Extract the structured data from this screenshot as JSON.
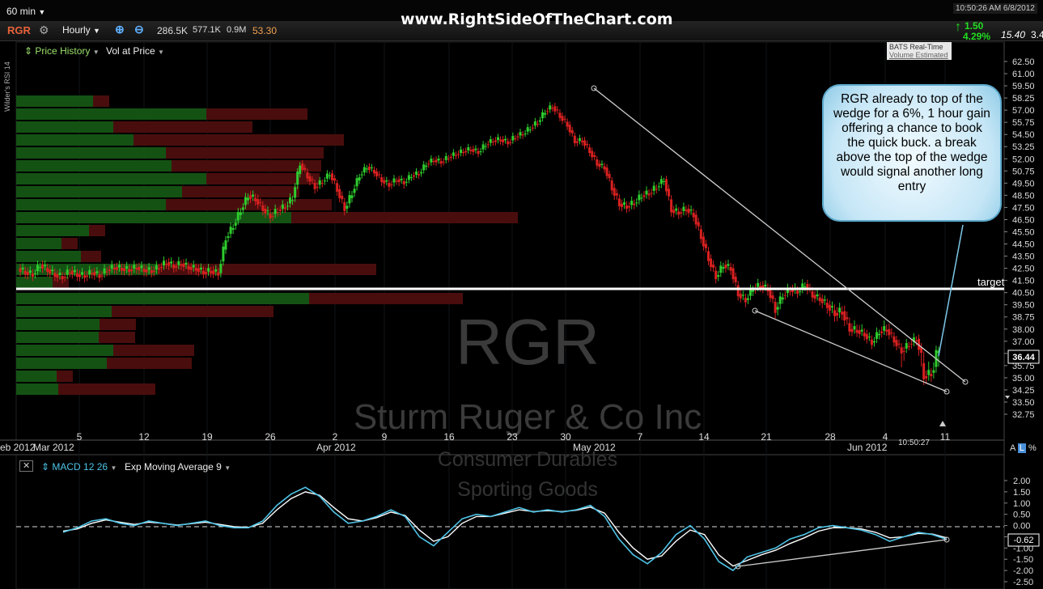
{
  "toolbar": {
    "interval": "60 min",
    "symbol": "RGR",
    "bar_period": "Hourly",
    "volume": "286.5K",
    "avg_vol": "577.1K",
    "vol_extra": "0.9M",
    "rsi_value": "53.30",
    "timestamp": "10:50:26 AM 6/8/2012",
    "bats_title": "BATS Real-Time",
    "bats_sub": "Volume Estimated",
    "change": "1.50",
    "change_pct": "4.29%",
    "last": "15.40",
    "last_extra": "3.4",
    "icons": [
      "chevron-down-icon",
      "settings-icon",
      "zoom-in-icon",
      "zoom-out-icon"
    ]
  },
  "brand": "www.RightSideOfTheChart.com",
  "panel1": {
    "label1": "Price History",
    "label2": "Vol at Price",
    "side_label": "Wilder's RSI 14",
    "watermark_symbol": "RGR",
    "watermark_company": "Sturm Ruger & Co Inc",
    "watermark_sector": "Consumer Durables",
    "watermark_industry": "Sporting Goods",
    "price_time_label": "10:50:27",
    "target_label": "target",
    "last_price_label": "36.44"
  },
  "panel2": {
    "label1": "MACD 12 26",
    "label2": "Exp Moving Average 9",
    "last_value_label": "-0.62",
    "scale_icons": [
      "A",
      "L",
      "%"
    ]
  },
  "callout": "RGR already to top of the wedge for a 6%, 1 hour gain offering  a chance to book the quick buck.  a break above the top of the wedge would signal another long entry",
  "colors": {
    "up": "#2ecc2e",
    "down": "#d82020",
    "macd": "#4fc3e6",
    "signal": "#ffffff",
    "target": "#ffffff",
    "wedge": "#d0d0d0",
    "callout_border": "#5da9cc"
  },
  "chart_data": [
    {
      "type": "line",
      "title": "RGR",
      "xlabel": "",
      "ylabel": "",
      "ylim": [
        32.75,
        62.5
      ],
      "x_tick_labels": [
        "eb 2012",
        "Mar 2012",
        "5",
        "12",
        "19",
        "26",
        "Apr 2012",
        "2",
        "9",
        "16",
        "23",
        "30",
        "May 2012",
        "7",
        "14",
        "21",
        "28",
        "4",
        "Jun 2012",
        "11"
      ],
      "y_tick_labels": [
        "62.50",
        "61.00",
        "59.50",
        "58.25",
        "57.00",
        "55.75",
        "54.50",
        "53.25",
        "52.00",
        "50.75",
        "49.50",
        "48.50",
        "47.50",
        "46.50",
        "45.50",
        "44.50",
        "43.50",
        "42.50",
        "41.50",
        "40.50",
        "39.50",
        "38.75",
        "38.00",
        "37.00",
        "36.00",
        "35.75",
        "35.00",
        "34.25",
        "33.50",
        "32.75"
      ],
      "series": [
        {
          "values": [
            42.5,
            42.2,
            42.0,
            42.8,
            42.4,
            42.0,
            41.8,
            42.3,
            42.0,
            41.9,
            42.2,
            41.9,
            42.4,
            42.6,
            42.5,
            42.4,
            42.6,
            42.4,
            42.3,
            42.6,
            43.0,
            42.7,
            42.9,
            42.6,
            42.5,
            42.2,
            42.3,
            42.1,
            45.0,
            46.0,
            47.3,
            48.5,
            48.2,
            47.4,
            46.8,
            47.3,
            47.6,
            48.3,
            51.5,
            50.2,
            49.2,
            49.7,
            50.5,
            49.0,
            47.4,
            48.7,
            50.3,
            51.2,
            50.7,
            49.8,
            49.4,
            49.9,
            49.6,
            50.3,
            50.5,
            51.5,
            51.9,
            51.7,
            52.2,
            52.5,
            52.8,
            53.0,
            52.7,
            53.5,
            53.9,
            54.0,
            53.7,
            54.3,
            54.6,
            55.2,
            55.8,
            56.9,
            57.4,
            56.4,
            55.5,
            53.8,
            53.9,
            52.8,
            51.5,
            51.1,
            49.1,
            47.8,
            47.6,
            47.9,
            48.5,
            48.7,
            49.2,
            49.9,
            47.3,
            47.1,
            47.4,
            46.9,
            45.1,
            43.3,
            41.8,
            42.8,
            42.5,
            40.4,
            39.9,
            40.9,
            41.1,
            40.8,
            39.2,
            40.3,
            40.8,
            40.6,
            41.2,
            40.3,
            40.0,
            39.5,
            39.0,
            39.1,
            38.0,
            37.9,
            37.6,
            36.9,
            37.8,
            38.0,
            37.1,
            36.2,
            36.8,
            37.2,
            35.1,
            35.3,
            36.4
          ]
        }
      ],
      "annotations": [
        {
          "text": "target",
          "price": 41.35,
          "kind": "horizontal line"
        },
        {
          "text": "wedge upper",
          "from": [
            59.2,
            "May 1"
          ],
          "to": [
            34.9,
            "Jun 12"
          ]
        },
        {
          "text": "wedge lower",
          "from": [
            39.5,
            "May 21"
          ],
          "to": [
            34.3,
            "Jun 11"
          ]
        }
      ]
    },
    {
      "type": "line",
      "title": "MACD 12 26 / Exp Moving Average 9",
      "ylim": [
        -2.5,
        2.0
      ],
      "y_tick_labels": [
        "2.00",
        "1.50",
        "1.00",
        "0.50",
        "0.00",
        "-0.50",
        "-1.00",
        "-1.50",
        "-2.00",
        "-2.50"
      ],
      "series": [
        {
          "name": "MACD 12 26",
          "values": [
            -0.3,
            -0.1,
            0.2,
            0.3,
            0.1,
            0.0,
            0.2,
            0.1,
            0.0,
            0.1,
            0.2,
            0.0,
            -0.1,
            -0.1,
            0.2,
            0.9,
            1.4,
            1.7,
            1.3,
            0.6,
            0.1,
            0.2,
            0.4,
            0.7,
            0.4,
            -0.5,
            -0.9,
            -0.3,
            0.3,
            0.5,
            0.4,
            0.6,
            0.8,
            0.6,
            0.7,
            0.6,
            0.7,
            0.9,
            0.4,
            -0.6,
            -1.3,
            -1.7,
            -1.2,
            -0.4,
            0.0,
            -0.6,
            -1.6,
            -2.0,
            -1.4,
            -1.2,
            -1.0,
            -0.6,
            -0.4,
            -0.1,
            0.0,
            -0.1,
            -0.2,
            -0.4,
            -0.7,
            -0.5,
            -0.3,
            -0.4,
            -0.62
          ]
        },
        {
          "name": "Exp Moving Average 9",
          "values": [
            -0.25,
            -0.15,
            0.1,
            0.25,
            0.15,
            0.05,
            0.15,
            0.1,
            0.02,
            0.08,
            0.15,
            0.05,
            -0.05,
            -0.08,
            0.1,
            0.7,
            1.2,
            1.5,
            1.35,
            0.8,
            0.3,
            0.2,
            0.35,
            0.6,
            0.45,
            -0.2,
            -0.7,
            -0.5,
            0.1,
            0.4,
            0.4,
            0.55,
            0.7,
            0.62,
            0.66,
            0.62,
            0.68,
            0.82,
            0.55,
            -0.3,
            -1.0,
            -1.5,
            -1.35,
            -0.7,
            -0.2,
            -0.4,
            -1.3,
            -1.8,
            -1.55,
            -1.3,
            -1.1,
            -0.8,
            -0.55,
            -0.25,
            -0.1,
            -0.1,
            -0.15,
            -0.3,
            -0.55,
            -0.5,
            -0.35,
            -0.38,
            -0.55
          ]
        }
      ]
    }
  ]
}
